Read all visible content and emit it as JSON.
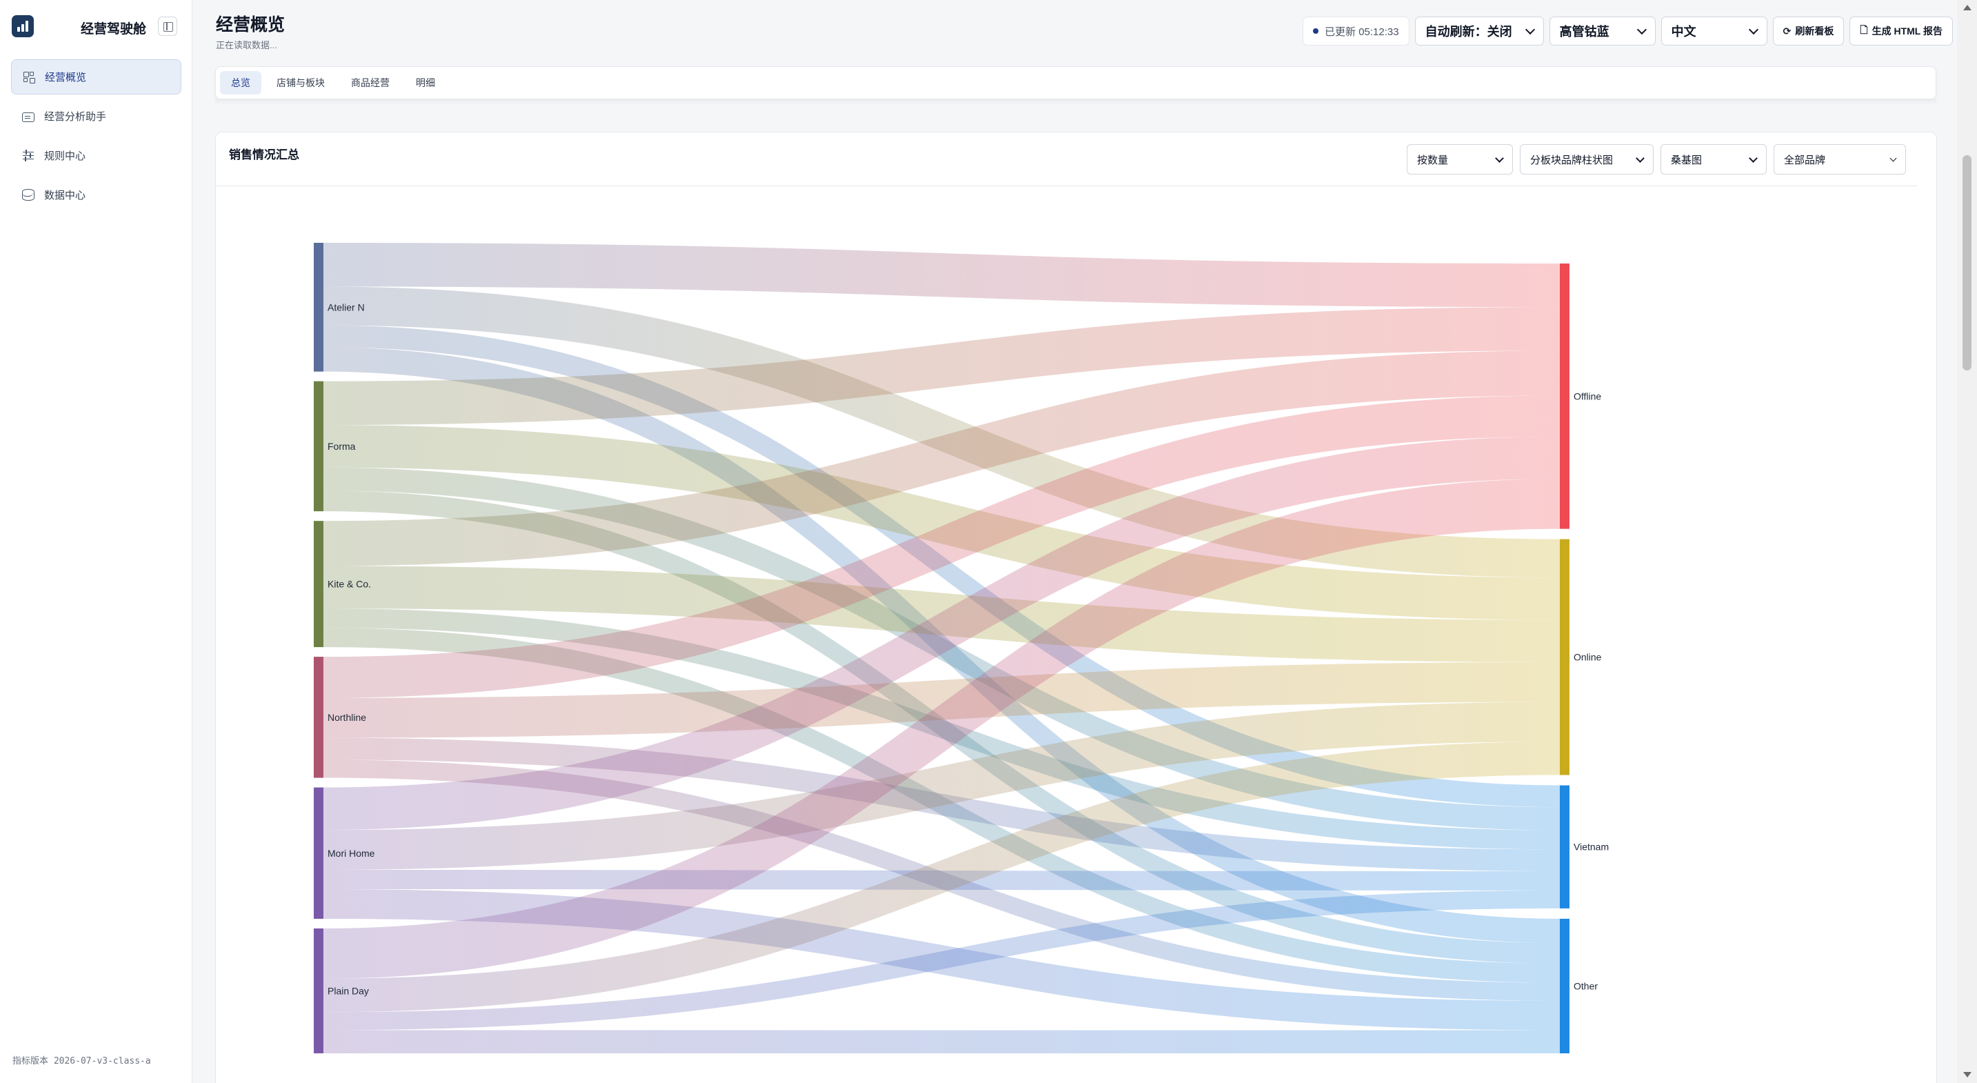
{
  "sidebar": {
    "brand_title": "经营驾驶舱",
    "items": [
      {
        "label": "经营概览",
        "icon": "dashboard-grid-icon",
        "active": true
      },
      {
        "label": "经营分析助手",
        "icon": "chat-icon",
        "active": false
      },
      {
        "label": "规则中心",
        "icon": "sliders-icon",
        "active": false
      },
      {
        "label": "数据中心",
        "icon": "database-icon",
        "active": false
      }
    ],
    "version": "指标版本 2026-07-v3-class-a"
  },
  "header": {
    "title": "经营概览",
    "subtitle": "正在读取数据...",
    "updated": "已更新 05:12:33",
    "auto_refresh": "自动刷新：关闭",
    "theme": "高管钴蓝",
    "language": "中文",
    "refresh_button": "刷新看板",
    "report_button": "生成 HTML 报告"
  },
  "tabs": [
    {
      "label": "总览",
      "active": true
    },
    {
      "label": "店铺与板块",
      "active": false
    },
    {
      "label": "商品经营",
      "active": false
    },
    {
      "label": "明细",
      "active": false
    }
  ],
  "card": {
    "title": "销售情况汇总",
    "controls": {
      "metric": "按数量",
      "view": "分板块品牌柱状图",
      "chart_type": "桑基图",
      "brand_filter": "全部品牌"
    }
  },
  "chart_data": {
    "type": "sankey",
    "sources": [
      {
        "name": "Atelier N",
        "color": "#5b6e99"
      },
      {
        "name": "Forma",
        "color": "#6e8045"
      },
      {
        "name": "Kite & Co.",
        "color": "#6e8045"
      },
      {
        "name": "Northline",
        "color": "#ad556e"
      },
      {
        "name": "Mori Home",
        "color": "#7a5aa8"
      },
      {
        "name": "Plain Day",
        "color": "#7a5aa8"
      }
    ],
    "targets": [
      {
        "name": "Offline",
        "color": "#ef4a52"
      },
      {
        "name": "Online",
        "color": "#c9ac1e"
      },
      {
        "name": "Vietnam",
        "color": "#1f88e3"
      },
      {
        "name": "Other",
        "color": "#1f88e3"
      }
    ],
    "links": [
      {
        "source": "Atelier N",
        "target": "Offline",
        "value": 34
      },
      {
        "source": "Atelier N",
        "target": "Online",
        "value": 30
      },
      {
        "source": "Atelier N",
        "target": "Vietnam",
        "value": 17
      },
      {
        "source": "Atelier N",
        "target": "Other",
        "value": 19
      },
      {
        "source": "Forma",
        "target": "Offline",
        "value": 34
      },
      {
        "source": "Forma",
        "target": "Online",
        "value": 33
      },
      {
        "source": "Forma",
        "target": "Vietnam",
        "value": 18
      },
      {
        "source": "Forma",
        "target": "Other",
        "value": 16
      },
      {
        "source": "Kite & Co.",
        "target": "Offline",
        "value": 35
      },
      {
        "source": "Kite & Co.",
        "target": "Online",
        "value": 33
      },
      {
        "source": "Kite & Co.",
        "target": "Vietnam",
        "value": 15
      },
      {
        "source": "Kite & Co.",
        "target": "Other",
        "value": 15
      },
      {
        "source": "Northline",
        "target": "Offline",
        "value": 32
      },
      {
        "source": "Northline",
        "target": "Online",
        "value": 31
      },
      {
        "source": "Northline",
        "target": "Vietnam",
        "value": 17
      },
      {
        "source": "Northline",
        "target": "Other",
        "value": 14
      },
      {
        "source": "Mori Home",
        "target": "Offline",
        "value": 33
      },
      {
        "source": "Mori Home",
        "target": "Online",
        "value": 31
      },
      {
        "source": "Mori Home",
        "target": "Vietnam",
        "value": 15
      },
      {
        "source": "Mori Home",
        "target": "Other",
        "value": 23
      },
      {
        "source": "Plain Day",
        "target": "Offline",
        "value": 39
      },
      {
        "source": "Plain Day",
        "target": "Online",
        "value": 26
      },
      {
        "source": "Plain Day",
        "target": "Vietnam",
        "value": 14
      },
      {
        "source": "Plain Day",
        "target": "Other",
        "value": 18
      }
    ]
  }
}
